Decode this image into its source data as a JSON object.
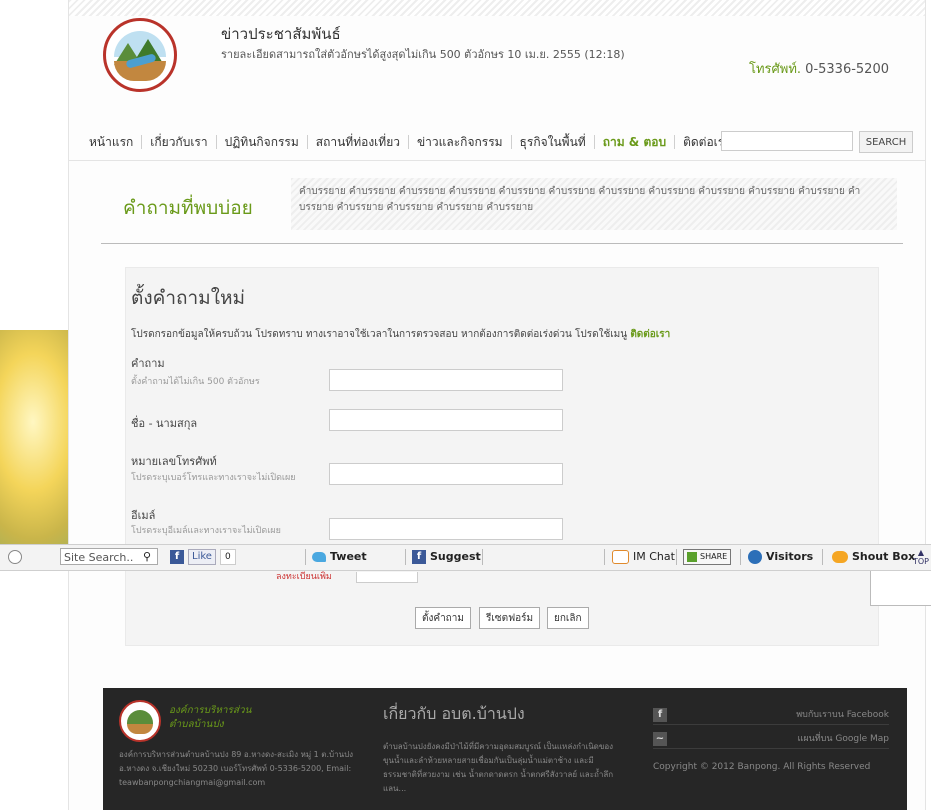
{
  "header": {
    "site_title": "ข่าวประชาสัมพันธ์",
    "site_subtitle": "รายละเอียดสามารถใส่ตัวอักษรได้สูงสุดไม่เกิน 500 ตัวอักษร 10 เม.ย. 2555 (12:18)",
    "phone_label": "โทรศัพท์.",
    "phone_number": "0-5336-5200"
  },
  "nav": {
    "items": [
      "หน้าแรก",
      "เกี่ยวกับเรา",
      "ปฏิทินกิจกรรม",
      "สถานที่ท่องเที่ยว",
      "ข่าวและกิจกรรม",
      "ธุรกิจในพื้นที่",
      "ถาม & ตอบ",
      "ติดต่อเรา"
    ],
    "active_index": 6,
    "search_button": "SEARCH"
  },
  "faq": {
    "title": "คำถามที่พบบ่อย",
    "description": "คำบรรยาย คำบรรยาย คำบรรยาย คำบรรยาย คำบรรยาย คำบรรยาย คำบรรยาย คำบรรยาย คำบรรยาย คำบรรยาย คำบรรยาย คำบรรยาย คำบรรยาย คำบรรยาย คำบรรยาย คำบรรยาย"
  },
  "form": {
    "heading": "ตั้งคำถามใหม่",
    "note": "โปรดกรอกข้อมูลให้ครบถ้วน โปรดทราบ ทางเราอาจใช้เวลาในการตรวจสอบ หากต้องการติดต่อเร่งด่วน โปรดใช้เมนู",
    "note_link": "ติดต่อเรา",
    "fields": [
      {
        "label": "คำถาม",
        "hint": "ตั้งคำถามได้ไม่เกิน 500 ตัวอักษร"
      },
      {
        "label": "ชื่อ - นามสกุล",
        "hint": ""
      },
      {
        "label": "หมายเลขโทรศัพท์",
        "hint": "โปรดระบุเบอร์โทรและทางเราจะไม่เปิดเผย"
      },
      {
        "label": "อีเมล์",
        "hint": "โปรดระบุอีเมล์และทางเราจะไม่เปิดเผย"
      }
    ],
    "partial_hint": "ลงทะเบียนเพิ่ม",
    "buttons": {
      "submit": "ตั้งคำถาม",
      "reset": "รีเซตฟอร์ม",
      "cancel": "ยกเลิก"
    }
  },
  "toolbar": {
    "search_placeholder": "Site Search..",
    "like": "Like",
    "like_count": "0",
    "tweet": "Tweet",
    "suggest": "Suggest",
    "im_chat": "IM Chat",
    "share": "SHARE",
    "visitors": "Visitors",
    "shout_box": "Shout Box",
    "top": "TOP"
  },
  "footer": {
    "org_name_line1": "องค์การบริหารส่วน",
    "org_name_line2": "ตำบลบ้านปง",
    "address": "องค์การบริหารส่วนตำบลบ้านปง 89 อ.หางดง-สะเมิง หมู่ 1 ต.บ้านปง อ.หางดง จ.เชียงใหม่ 50230 เบอร์โทรศัพท์ 0-5336-5200, Email: teawbanpongchiangmai@gmail.com",
    "about_heading": "เกี่ยวกับ อบต.บ้านปง",
    "about_text": "ตำบลบ้านปงยังคงมีป่าไม้ที่มีความอุดมสมบูรณ์ เป็นแหล่งกำเนิดของขุนน้ำและลำห้วยหลายสายเชื่อมกันเป็นลุ่มน้ำแม่ตาช้าง และมีธรรมชาติที่สวยงาม เช่น น้ำตกดาดตรก น้ำตกศรีสังวาลย์ และถ้ำลึกแลน...",
    "facebook_link": "พบกับเราบน Facebook",
    "map_link": "แผนที่บน Google Map",
    "copyright": "Copyright © 2012 Banpong. All Rights Reserved"
  }
}
